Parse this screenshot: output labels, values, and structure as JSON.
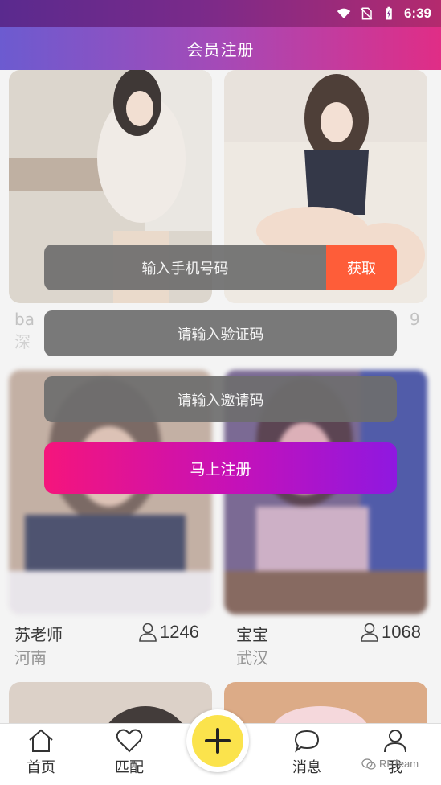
{
  "status_bar": {
    "time": "6:39",
    "icons": [
      "wifi-icon",
      "no-sim-icon",
      "battery-icon"
    ]
  },
  "header": {
    "title": "会员注册"
  },
  "cards": [
    {
      "name": "ba",
      "city": "深",
      "likes": "9"
    },
    {
      "name": "苏老师",
      "city": "河南",
      "likes": "1246"
    },
    {
      "name": "宝宝",
      "city": "武汉",
      "likes": "1068"
    }
  ],
  "form": {
    "phone_placeholder": "输入手机号码",
    "get_code_label": "获取",
    "code_placeholder": "请输入验证码",
    "invite_placeholder": "请输入邀请码",
    "submit_label": "马上注册"
  },
  "nav": {
    "home": "首页",
    "match": "匹配",
    "messages": "消息",
    "me": "我"
  },
  "watermark": "RFTeam",
  "colors": {
    "accent_orange": "#fe5d39",
    "fab_yellow": "#fbe34c",
    "register_gradient_start": "#f5157c",
    "register_gradient_end": "#8f18e0"
  }
}
